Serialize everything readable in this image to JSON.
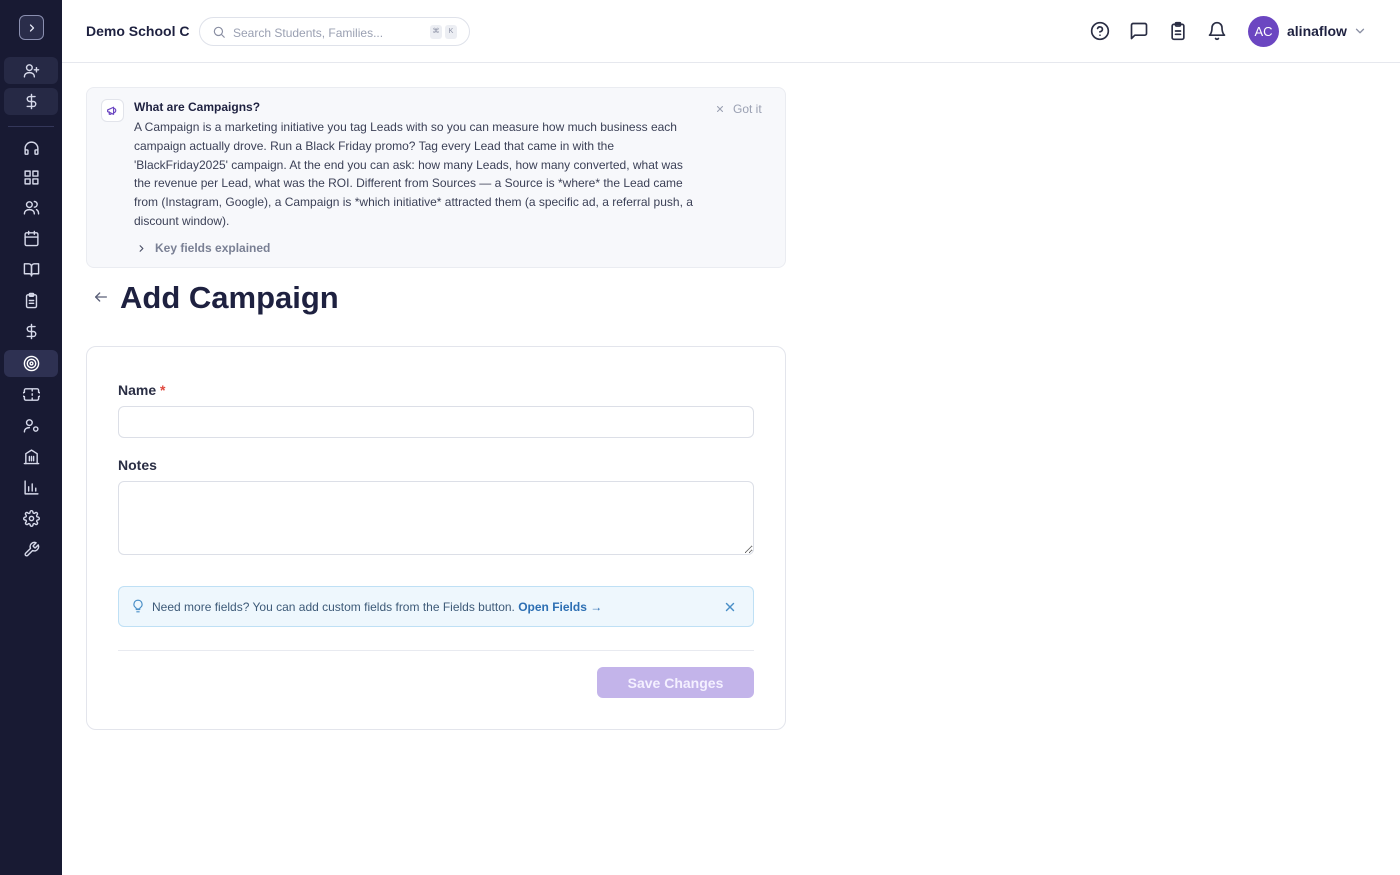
{
  "app": {
    "school_name": "Demo School C",
    "accent_color": "#6b46c1",
    "sidebar_bg": "#181a33"
  },
  "search": {
    "placeholder": "Search Students, Families...",
    "shortcut_keys": [
      "⌘",
      "K"
    ]
  },
  "topbar": {
    "icons": [
      "help-circle-icon",
      "chat-icon",
      "clipboard-icon",
      "bell-icon"
    ],
    "user": {
      "initials": "AC",
      "name": "alinaflow"
    }
  },
  "sidebar": {
    "items": [
      {
        "icon": "user-plus-icon",
        "name": "sidebar-item-leads"
      },
      {
        "icon": "dollar-icon",
        "name": "sidebar-item-billing"
      },
      {
        "icon": "headset-icon",
        "name": "sidebar-item-support"
      },
      {
        "icon": "dashboard-icon",
        "name": "sidebar-item-dashboard"
      },
      {
        "icon": "users-icon",
        "name": "sidebar-item-students"
      },
      {
        "icon": "calendar-icon",
        "name": "sidebar-item-calendar"
      },
      {
        "icon": "book-icon",
        "name": "sidebar-item-courses"
      },
      {
        "icon": "clipboard-icon",
        "name": "sidebar-item-tasks"
      },
      {
        "icon": "dollar-icon",
        "name": "sidebar-item-finance"
      },
      {
        "icon": "target-icon",
        "name": "sidebar-item-campaigns",
        "active": true
      },
      {
        "icon": "ticket-icon",
        "name": "sidebar-item-tickets"
      },
      {
        "icon": "user-settings-icon",
        "name": "sidebar-item-staff"
      },
      {
        "icon": "building-icon",
        "name": "sidebar-item-locations"
      },
      {
        "icon": "chart-icon",
        "name": "sidebar-item-reports"
      },
      {
        "icon": "gear-icon",
        "name": "sidebar-item-settings"
      },
      {
        "icon": "wrench-icon",
        "name": "sidebar-item-tools"
      }
    ]
  },
  "info_box": {
    "title": "What are Campaigns?",
    "body": "A Campaign is a marketing initiative you tag Leads with so you can measure how much business each campaign actually drove. Run a Black Friday promo? Tag every Lead that came in with the 'BlackFriday2025' campaign. At the end you can ask: how many Leads, how many converted, what was the revenue per Lead, what was the ROI. Different from Sources — a Source is *where* the Lead came from (Instagram, Google), a Campaign is *which initiative* attracted them (a specific ad, a referral push, a discount window).",
    "dismiss_label": "Got it",
    "expander_label": "Key fields explained"
  },
  "page": {
    "title": "Add Campaign"
  },
  "form": {
    "name_label": "Name",
    "required_marker": "*",
    "name_value": "",
    "notes_label": "Notes",
    "notes_value": "",
    "tip_text": "Need more fields? You can add custom fields from the Fields button.",
    "tip_link": "Open Fields →",
    "save_label": "Save Changes"
  }
}
